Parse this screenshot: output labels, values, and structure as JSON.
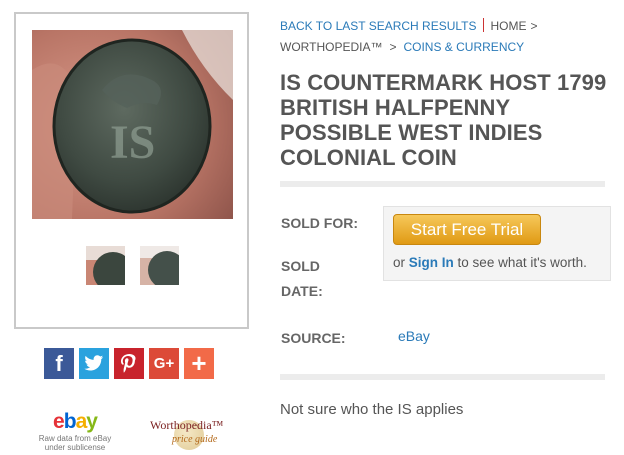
{
  "breadcrumb": {
    "back_label": "BACK TO LAST SEARCH RESULTS",
    "home_label": "HOME",
    "site_label": "WORTHOPEDIA™",
    "category_label": "COINS & CURRENCY",
    "separator": ">"
  },
  "item": {
    "title": "IS COUNTERMARK HOST 1799 BRITISH HALFPENNY POSSIBLE WEST INDIES COLONIAL COIN",
    "description": "Not sure who the IS applies"
  },
  "details": {
    "sold_for_label": "SOLD FOR:",
    "sold_date_label": "SOLD DATE:",
    "source_label": "SOURCE:",
    "source_value": "eBay"
  },
  "pricing": {
    "trial_button": "Start Free Trial",
    "signin_prefix": "or",
    "signin_link": "Sign In",
    "signin_suffix": "to see what it's worth."
  },
  "share": {
    "facebook_glyph": "f",
    "googleplus_glyph": "G+",
    "more_glyph": "+"
  },
  "logos": {
    "ebay_e": "e",
    "ebay_b": "b",
    "ebay_a": "a",
    "ebay_y": "y",
    "ebay_caption_1": "Raw data from eBay",
    "ebay_caption_2": "under sublicense",
    "worthopedia_title": "Worthopedia™",
    "worthopedia_sub": "price guide"
  },
  "colors": {
    "link": "#2a7ab8",
    "title": "#555555",
    "trial_button": "#e9aa2e",
    "facebook": "#3b5998",
    "twitter": "#2aa2de",
    "pinterest": "#c8232c",
    "googleplus": "#dc4a38",
    "more": "#f26a48"
  },
  "icons": {
    "facebook": "facebook-icon",
    "twitter": "twitter-bird-icon",
    "pinterest": "pinterest-icon",
    "googleplus": "google-plus-icon",
    "more": "plus-icon"
  }
}
